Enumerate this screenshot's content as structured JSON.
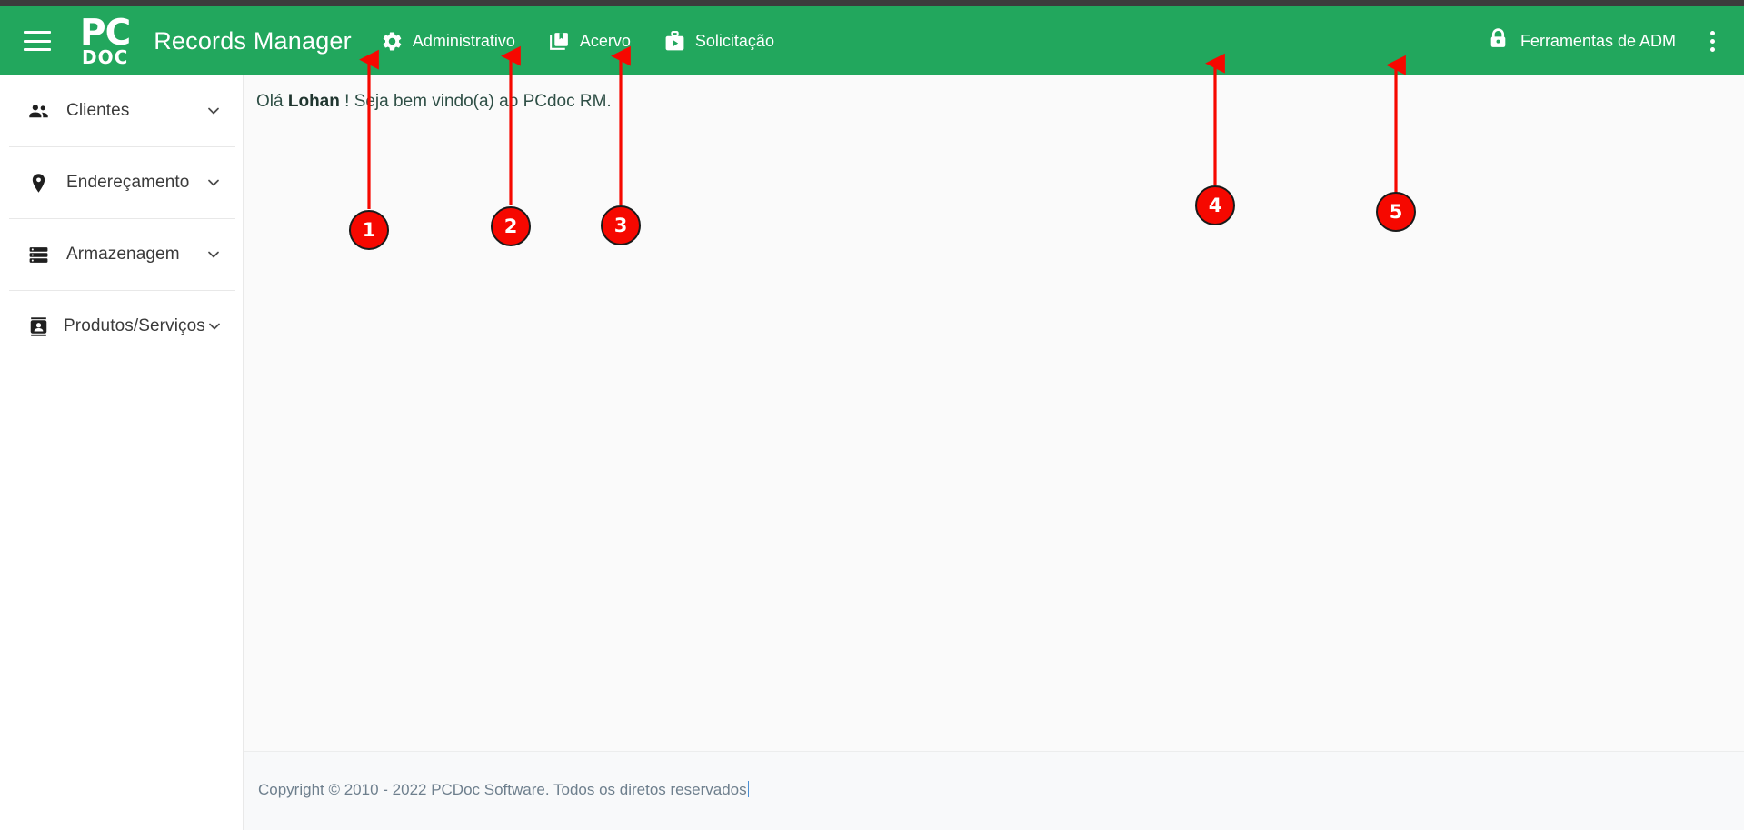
{
  "header": {
    "menu_icon": "hamburger-icon",
    "logo_line1": "PC",
    "logo_line2": "DOC",
    "title": "Records Manager",
    "nav": [
      {
        "label": "Administrativo",
        "icon": "gear-icon"
      },
      {
        "label": "Acervo",
        "icon": "collection-book-icon"
      },
      {
        "label": "Solicitação",
        "icon": "briefcase-play-icon"
      }
    ],
    "adm_tools": {
      "label": "Ferramentas de ADM",
      "icon": "lock-icon"
    },
    "overflow_menu_icon": "kebab-menu-icon",
    "background_color": "#22a75d"
  },
  "sidebar": {
    "items": [
      {
        "label": "Clientes",
        "icon": "people-icon",
        "expand_icon": "chevron-down-icon"
      },
      {
        "label": "Endereçamento",
        "icon": "location-pin-icon",
        "expand_icon": "chevron-down-icon"
      },
      {
        "label": "Armazenagem",
        "icon": "storage-icon",
        "expand_icon": "chevron-down-icon"
      },
      {
        "label": "Produtos/Serviços",
        "icon": "contact-card-icon",
        "expand_icon": "chevron-down-icon"
      }
    ]
  },
  "main": {
    "greeting_prefix": "Olá ",
    "greeting_user": "Lohan",
    "greeting_suffix": " ! Seja bem vindo(a) ao PCdoc RM."
  },
  "footer": {
    "copyright": "Copyright © 2010 - 2022 PCDoc Software. Todos os diretos reservados"
  },
  "annotations": {
    "color": "#f60800",
    "markers": [
      {
        "number": "1",
        "target": "nav-administrativo"
      },
      {
        "number": "2",
        "target": "nav-acervo"
      },
      {
        "number": "3",
        "target": "nav-solicitacao"
      },
      {
        "number": "4",
        "target": "ferramentas-de-adm"
      },
      {
        "number": "5",
        "target": "overflow-menu"
      }
    ]
  }
}
